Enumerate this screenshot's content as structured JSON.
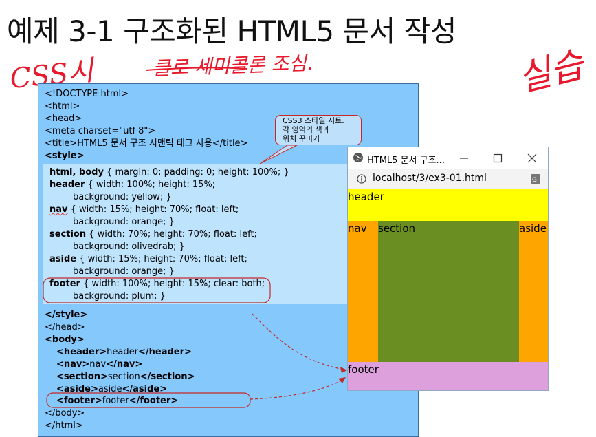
{
  "slide": {
    "title": "예제 3-1 구조화된 HTML5 문서 작성"
  },
  "annotations": {
    "css": "CSS시",
    "note": "클로 세미콜론 조심.",
    "practice": "실습"
  },
  "callout": {
    "text": "CSS3 스타일 시트.\n각 영역의 색과\n위치 꾸미기"
  },
  "code": {
    "head_lines": [
      "<!DOCTYPE html>",
      "<html>",
      "<head>",
      "<meta charset=\"utf-8\">",
      "<title>HTML5 문서 구조 시맨틱 태그 사용</title>",
      "<style>"
    ],
    "css_rules": [
      {
        "selector": "html, body",
        "decl": " { margin: 0; padding: 0; height: 100%; }",
        "cont": ""
      },
      {
        "selector": "header",
        "decl": " { width: 100%; height: 15%;",
        "cont": "background: yellow; }"
      },
      {
        "selector": "nav",
        "decl": " { width: 15%; height: 70%; float: left;",
        "cont": "background: orange; }"
      },
      {
        "selector": "section",
        "decl": " { width: 70%; height: 70%; float: left;",
        "cont": "background: olivedrab; }"
      },
      {
        "selector": "aside",
        "decl": " { width: 15%; height: 70%; float: left;",
        "cont": "background: orange; }"
      },
      {
        "selector": "footer",
        "decl": " { width: 100%; height: 15%; clear: both;",
        "cont": "background: plum; }"
      }
    ],
    "tail": {
      "style_close": "</style>",
      "head_close": "</head>",
      "body_open": "<body>",
      "tags": [
        {
          "open": "<header>",
          "text": "header",
          "close": "</header>"
        },
        {
          "open": "<nav>",
          "text": "nav",
          "close": "</nav>"
        },
        {
          "open": "<section>",
          "text": "section",
          "close": "</section>"
        },
        {
          "open": "<aside>",
          "text": "aside",
          "close": "</aside>"
        },
        {
          "open": "<footer>",
          "text": "footer",
          "close": "</footer>"
        }
      ],
      "body_close": "</body>",
      "html_close": "</html>"
    }
  },
  "browser": {
    "tab_title": "HTML5 문서 구조...",
    "url": "localhost/3/ex3-01.html",
    "page": {
      "header": {
        "label": "header",
        "color": "#ffff00"
      },
      "nav": {
        "label": "nav",
        "color": "#ffa500"
      },
      "section": {
        "label": "section",
        "color": "#6b8e23"
      },
      "aside": {
        "label": "aside",
        "color": "#ffa500"
      },
      "footer": {
        "label": "footer",
        "color": "#dda0dd"
      }
    }
  },
  "colors": {
    "code_bg": "#85c8fb",
    "style_bg": "#bde3fd",
    "annotation_red": "#e8192c"
  }
}
